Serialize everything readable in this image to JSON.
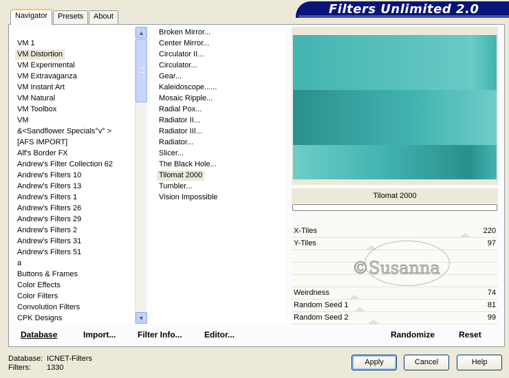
{
  "banner": {
    "title": "Filters Unlimited 2.0"
  },
  "tabs": [
    {
      "label": "Navigator"
    },
    {
      "label": "Presets"
    },
    {
      "label": "About"
    }
  ],
  "categories": {
    "selected_index": 1,
    "items": [
      "VM 1",
      "VM Distortion",
      "VM Experimental",
      "VM Extravaganza",
      "VM Instant Art",
      "VM Natural",
      "VM Toolbox",
      "VM",
      "&<Sandflower Specials°v° >",
      "[AFS IMPORT]",
      "Alf's Border FX",
      "Andrew's Filter Collection 62",
      "Andrew's Filters 10",
      "Andrew's Filters 13",
      "Andrew's Filters 1",
      "Andrew's Filters 26",
      "Andrew's Filters 29",
      "Andrew's Filters 2",
      "Andrew's Filters 31",
      "Andrew's Filters 51",
      "a",
      "Buttons & Frames",
      "Color Effects",
      "Color Filters",
      "Convolution Filters",
      "CPK Designs"
    ]
  },
  "filters": {
    "selected_index": 13,
    "items": [
      "Broken Mirror...",
      "Center Mirror...",
      "Circulator II...",
      "Circulator...",
      "Gear...",
      "Kaleidoscope......",
      "Mosaic Ripple...",
      "Radial Pox...",
      "Radiator II...",
      "Radiator III...",
      "Radiator...",
      "Slicer...",
      "The Black Hole...",
      "Tilomat 2000",
      "Tumbler...",
      "Vision Impossible"
    ]
  },
  "preview": {
    "filter_name": "Tilomat 2000",
    "colors": {
      "teal_light": "#6ecdc8",
      "teal_mid": "#43b4b0",
      "teal_dark": "#2a8f8d"
    }
  },
  "sliders": [
    {
      "label": "X-Tiles",
      "value": 220,
      "fraction": 0.86
    },
    {
      "label": "Y-Tiles",
      "value": 97,
      "fraction": 0.38
    },
    {
      "label": "",
      "value": null,
      "fraction": null
    },
    {
      "label": "",
      "value": null,
      "fraction": null
    },
    {
      "label": "",
      "value": null,
      "fraction": null
    },
    {
      "label": "Weirdness",
      "value": 74,
      "fraction": 0.29
    },
    {
      "label": "Random Seed 1",
      "value": 81,
      "fraction": 0.32
    },
    {
      "label": "Random Seed 2",
      "value": 99,
      "fraction": 0.39
    }
  ],
  "watermark": "©Susanna",
  "actions": {
    "database": "Database",
    "import": "Import...",
    "filter_info": "Filter Info...",
    "editor": "Editor...",
    "randomize": "Randomize",
    "reset": "Reset"
  },
  "status": {
    "database_label": "Database:",
    "database_value": "ICNET-Filters",
    "filters_label": "Filters:",
    "filters_value": "1330"
  },
  "buttons": {
    "apply": "Apply",
    "cancel": "Cancel",
    "help": "Help"
  }
}
